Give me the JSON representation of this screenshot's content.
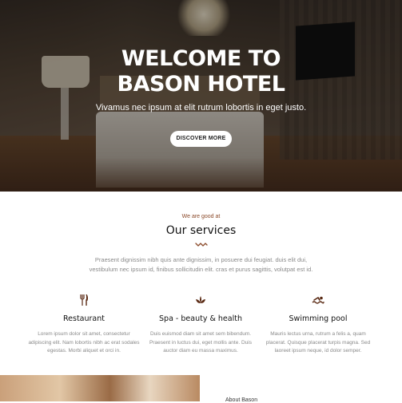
{
  "hero": {
    "title_line1": "WELCOME TO",
    "title_line2": "BASON HOTEL",
    "subtitle": "Vivamus nec ipsum at elit rutrum lobortis in eget justo.",
    "cta_label": "DISCOVER MORE"
  },
  "services": {
    "eyebrow": "We are good at",
    "title": "Our services",
    "intro": "Praesent dignissim nibh quis ante dignissim, in posuere dui feugiat. duis elit dui, vestibulum nec ipsum id, finibus sollicitudin elit. cras et purus sagittis, volutpat est id.",
    "items": [
      {
        "icon": "restaurant-icon",
        "name": "Restaurant",
        "desc": "Lorem ipsum dolor sit amet, consectetur adipiscing elit. Nam lobortis nibh ac erat sodales egestas. Morbi aliquet et orci in."
      },
      {
        "icon": "spa-icon",
        "name": "Spa - beauty & health",
        "desc": "Duis euismod diam sit amet sem bibendum. Praesent in luctus dui, eget mollis ante. Duis auctor diam eu massa maximus."
      },
      {
        "icon": "swimming-pool-icon",
        "name": "Swimming pool",
        "desc": "Mauris lectus urna, rutrum a felis a, quam placerat. Quisque placerat turpis magna. Sed laoreet ipsum neque, id dolor semper."
      }
    ]
  },
  "about": {
    "label": "About Bason"
  },
  "colors": {
    "accent": "#8b4a2a",
    "text": "#111111",
    "muted": "#8a8a8a"
  }
}
